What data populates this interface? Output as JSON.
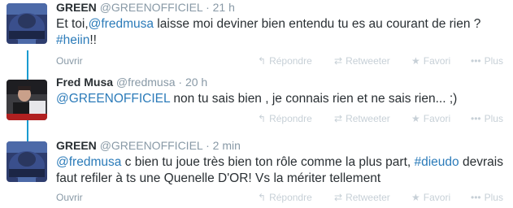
{
  "tweets": [
    {
      "fullname": "GREEN",
      "username": "@GREENOFFICIEL",
      "time": "21 h",
      "text_parts": [
        "Et toi,",
        "@fredmusa",
        " laisse moi deviner bien entendu tu es au courant de rien ?",
        "#heiin",
        "!!"
      ],
      "avatar": "green-avatar"
    },
    {
      "fullname": "Fred Musa",
      "username": "@fredmusa",
      "time": "20 h",
      "text_parts": [
        "@GREENOFFICIEL",
        " non tu sais bien , je connais rien et ne sais rien... ;)"
      ],
      "avatar": "fred-avatar"
    },
    {
      "fullname": "GREEN",
      "username": "@GREENOFFICIEL",
      "time": "2 min",
      "text_parts": [
        "@fredmusa",
        " c bien tu joue très bien ton rôle comme la plus part, ",
        "#dieudo",
        " devrais faut refiler à ts une Quenelle D'OR! Vs la mériter tellement"
      ],
      "avatar": "green-avatar"
    }
  ],
  "actions": {
    "open": "Ouvrir",
    "reply": "Répondre",
    "retweet": "Retweeter",
    "favorite": "Favori",
    "more": "Plus"
  },
  "icons": {
    "reply": "reply-icon",
    "retweet": "retweet-icon",
    "favorite": "star-icon",
    "more": "more-dots-icon"
  },
  "colors": {
    "link": "#2b7bb9",
    "conversation_line": "#1a9bd0",
    "muted": "#8899a6",
    "action": "#c7d0d7"
  },
  "separator": "·"
}
